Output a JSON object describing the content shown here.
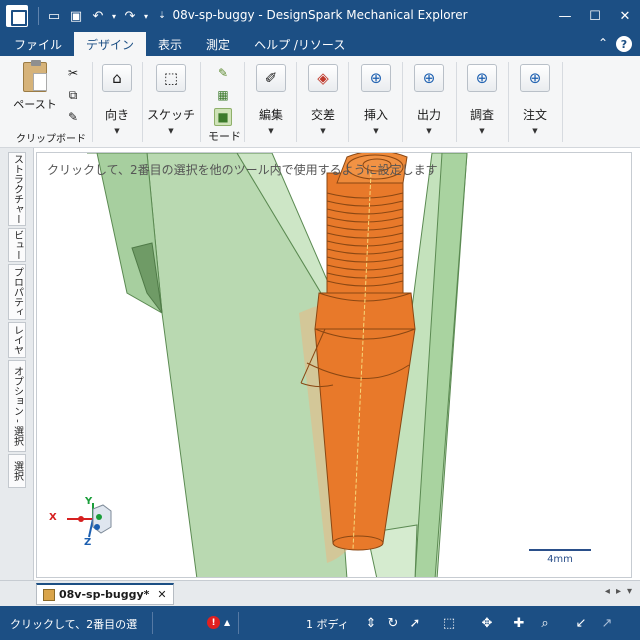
{
  "window": {
    "title": "08v-sp-buggy - DesignSpark Mechanical Explorer",
    "minimize_icon": "minimize-icon",
    "maximize_icon": "maximize-icon",
    "close_icon": "close-icon"
  },
  "menu": {
    "tabs": [
      {
        "label": "ファイル"
      },
      {
        "label": "デザイン"
      },
      {
        "label": "表示"
      },
      {
        "label": "測定"
      },
      {
        "label": "ヘルプ /リソース"
      }
    ],
    "active_tab": "デザイン",
    "help_glyph": "?"
  },
  "ribbon": {
    "clipboard": {
      "paste": "ペースト",
      "group_label": "クリップボード"
    },
    "orient": "向き",
    "sketch": "スケッチ",
    "mode": "モード",
    "edit": "編集",
    "intersect": "交差",
    "insert": "挿入",
    "output": "出力",
    "investigate": "調査",
    "order": "注文"
  },
  "left_tabs": [
    {
      "label": "ストラクチャー"
    },
    {
      "label": "ビュー"
    },
    {
      "label": "プロパティ"
    },
    {
      "label": "レイヤ"
    },
    {
      "label": "オプション - 選択"
    },
    {
      "label": "選択"
    }
  ],
  "viewport": {
    "hint": "クリックして、2番目の選択を他のツール内で使用するように設定します",
    "scale_label": "4mm",
    "triad": {
      "x": "X",
      "y": "Y",
      "z": "Z"
    }
  },
  "document": {
    "tab_label": "08v-sp-buggy*",
    "close_glyph": "✕"
  },
  "status": {
    "message": "クリックして、2番目の選",
    "error_glyph": "!",
    "selection_count": "1 ボディ"
  },
  "colors": {
    "brand": "#1c4f84",
    "part_orange": "#e8792a",
    "frame_green": "#b8d9b0"
  }
}
